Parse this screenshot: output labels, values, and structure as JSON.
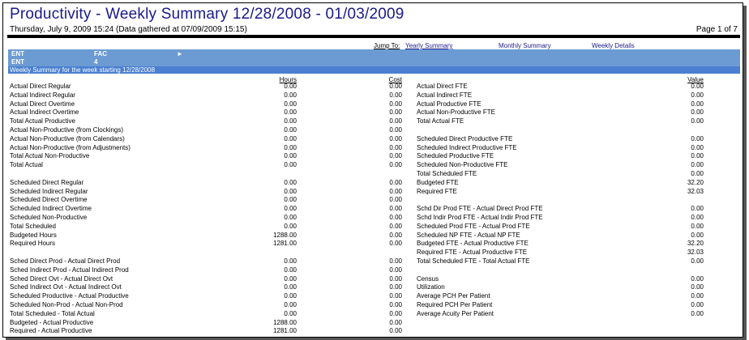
{
  "header": {
    "title": "Productivity - Weekly Summary  12/28/2008 - 01/03/2009",
    "subtitle": "Thursday, July 9, 2009 15:24    (Data gathered at 07/09/2009 15:15)",
    "page": "Page 1 of 7"
  },
  "jump": {
    "label": "Jump To:",
    "yearly": "Yearly Summary",
    "monthly": "Monthly Summary",
    "weekly": "Weekly Details"
  },
  "banner": {
    "ent_label": "ENT",
    "fac_label": "FAC",
    "arrow": "►",
    "ent_value": "ENT",
    "fac_value": "4",
    "week_text": "Weekly Summary for the week starting 12/28/2008"
  },
  "columns": {
    "hours": "Hours",
    "cost": "Cost",
    "value": "Value"
  },
  "left_rows": [
    {
      "label": "Actual Direct Regular",
      "hours": "0.00",
      "cost": "0.00"
    },
    {
      "label": "Actual Indirect Regular",
      "hours": "0.00",
      "cost": "0.00"
    },
    {
      "label": "Actual Direct Overtime",
      "hours": "0.00",
      "cost": "0.00"
    },
    {
      "label": "Actual Indirect Overtime",
      "hours": "0.00",
      "cost": "0.00"
    },
    {
      "label": "Total Actual Productive",
      "hours": "0.00",
      "cost": "0.00"
    },
    {
      "label": "Actual Non-Productive (from Clockings)",
      "hours": "0.00",
      "cost": "0.00"
    },
    {
      "label": "Actual Non-Productive (from Calendars)",
      "hours": "0.00",
      "cost": "0.00"
    },
    {
      "label": "Actual Non-Productive (from Adjustments)",
      "hours": "0.00",
      "cost": "0.00"
    },
    {
      "label": "Total Actual Non-Productive",
      "hours": "0.00",
      "cost": "0.00"
    },
    {
      "label": "Total Actual",
      "hours": "0.00",
      "cost": "0.00"
    },
    {
      "label": "",
      "hours": "",
      "cost": ""
    },
    {
      "label": "Scheduled Direct Regular",
      "hours": "0.00",
      "cost": "0.00"
    },
    {
      "label": "Scheduled Indirect Regular",
      "hours": "0.00",
      "cost": "0.00"
    },
    {
      "label": "Scheduled Direct Overtime",
      "hours": "0.00",
      "cost": "0.00"
    },
    {
      "label": "Scheduled Indirect Overtime",
      "hours": "0.00",
      "cost": "0.00"
    },
    {
      "label": "Scheduled Non-Productive",
      "hours": "0.00",
      "cost": "0.00"
    },
    {
      "label": "Total Scheduled",
      "hours": "0.00",
      "cost": "0.00"
    },
    {
      "label": "Budgeted Hours",
      "hours": "1288.00",
      "cost": "0.00"
    },
    {
      "label": "Required Hours",
      "hours": "1281.00",
      "cost": "0.00"
    },
    {
      "label": "",
      "hours": "",
      "cost": ""
    },
    {
      "label": "Sched Direct Prod - Actual Direct Prod",
      "hours": "0.00",
      "cost": "0.00"
    },
    {
      "label": "Sched Indirect Prod - Actual Indirect Prod",
      "hours": "0.00",
      "cost": "0.00"
    },
    {
      "label": "Sched Direct Ovt - Actual Direct Ovt",
      "hours": "0.00",
      "cost": "0.00"
    },
    {
      "label": "Sched Indirect Ovt - Actual Indirect Ovt",
      "hours": "0.00",
      "cost": "0.00"
    },
    {
      "label": "Scheduled Productive - Actual Productive",
      "hours": "0.00",
      "cost": "0.00"
    },
    {
      "label": "Scheduled Non-Prod - Actual Non-Prod",
      "hours": "0.00",
      "cost": "0.00"
    },
    {
      "label": "Total Scheduled - Total Actual",
      "hours": "0.00",
      "cost": "0.00"
    },
    {
      "label": "Budgeted - Actual Productive",
      "hours": "1288.00",
      "cost": "0.00"
    },
    {
      "label": "Required - Actual Productive",
      "hours": "1281.00",
      "cost": "0.00"
    }
  ],
  "right_rows": [
    {
      "label": "Actual Direct FTE",
      "value": "0.00"
    },
    {
      "label": "Actual Indirect FTE",
      "value": "0.00"
    },
    {
      "label": "Actual Productive FTE",
      "value": "0.00"
    },
    {
      "label": "Actual Non-Productive FTE",
      "value": "0.00"
    },
    {
      "label": "Total Actual FTE",
      "value": "0.00"
    },
    {
      "label": "",
      "value": ""
    },
    {
      "label": "Scheduled Direct Productive FTE",
      "value": "0.00"
    },
    {
      "label": "Scheduled Indirect Productive FTE",
      "value": "0.00"
    },
    {
      "label": "Scheduled Productive FTE",
      "value": "0.00"
    },
    {
      "label": "Scheduled Non-Productive FTE",
      "value": "0.00"
    },
    {
      "label": "Total Scheduled FTE",
      "value": "0.00"
    },
    {
      "label": "Budgeted FTE",
      "value": "32.20"
    },
    {
      "label": "Required FTE",
      "value": "32.03"
    },
    {
      "label": "",
      "value": ""
    },
    {
      "label": "Schd Dir Prod FTE - Actual Direct Prod FTE",
      "value": "0.00"
    },
    {
      "label": "Schd Indir Prod FTE - Actual Indir Prod FTE",
      "value": "0.00"
    },
    {
      "label": "Scheduled Prod FTE - Actual Prod FTE",
      "value": "0.00"
    },
    {
      "label": "Scheduled NP FTE - Actual NP FTE",
      "value": "0.00"
    },
    {
      "label": "Budgeted FTE - Actual Productive FTE",
      "value": "32.20"
    },
    {
      "label": "Required FTE - Actual Productive FTE",
      "value": "32.03"
    },
    {
      "label": "Total Scheduled FTE - Total Actual FTE",
      "value": "0.00"
    },
    {
      "label": "",
      "value": ""
    },
    {
      "label": "Census",
      "value": "0.00"
    },
    {
      "label": "Utilization",
      "value": "0.00"
    },
    {
      "label": "Average PCH Per Patient",
      "value": "0.00"
    },
    {
      "label": "Required PCH Per Patient",
      "value": "0.00"
    },
    {
      "label": "Average Acuity Per Patient",
      "value": "0.00"
    }
  ]
}
